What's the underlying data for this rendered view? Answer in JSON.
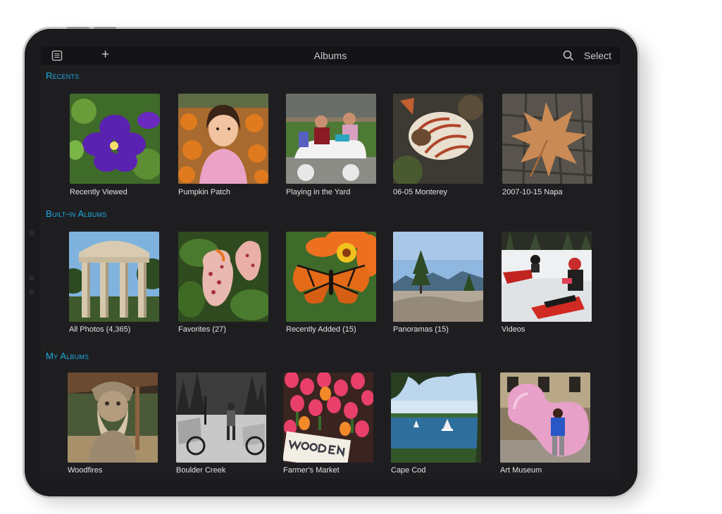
{
  "nav": {
    "title": "Albums",
    "select_label": "Select",
    "sidebar_icon": "sidebar-icon",
    "add_icon": "plus-icon",
    "add_glyph": "+",
    "search_icon": "search-icon"
  },
  "colors": {
    "accent": "#21aadf",
    "screen_bg": "#1e1e21",
    "nav_bg": "#141416",
    "text": "#e2e2e4"
  },
  "sections": [
    {
      "title": "Recents",
      "albums": [
        {
          "label": "Recently Viewed"
        },
        {
          "label": "Pumpkin Patch"
        },
        {
          "label": "Playing in the Yard"
        },
        {
          "label": "06-05 Monterey"
        },
        {
          "label": "2007-10-15 Napa"
        }
      ]
    },
    {
      "title": "Built-in Albums",
      "albums": [
        {
          "label": "All Photos (4,365)"
        },
        {
          "label": "Favorites (27)"
        },
        {
          "label": "Recently Added (15)"
        },
        {
          "label": "Panoramas (15)"
        },
        {
          "label": "Videos"
        }
      ]
    },
    {
      "title": "My Albums",
      "albums": [
        {
          "label": "Woodfires"
        },
        {
          "label": "Boulder Creek"
        },
        {
          "label": "Farmer's Market"
        },
        {
          "label": "Cape Cod"
        },
        {
          "label": "Art Museum"
        }
      ]
    }
  ]
}
